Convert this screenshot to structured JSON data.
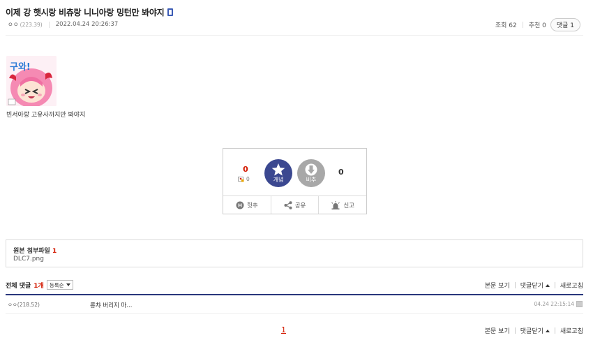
{
  "post": {
    "title": "이제 강 햇시랑 비츄랑 니니아랑 밍턴만 봐야지",
    "writer_name": "ㅇㅇ",
    "writer_ip": "(223.39)",
    "date": "2022.04.24 20:26:37",
    "views_label": "조회 62",
    "recommend_label": "추천 0",
    "comments_pill": "댓글 1",
    "sticker_text": "구와!",
    "body_text": "빈서아랑 고유사까지만 봐야지"
  },
  "vote": {
    "up_count": "0",
    "fixed_count": "0",
    "up_label": "개념",
    "down_label": "비추",
    "down_count": "0",
    "bottom": {
      "hit_label": "힛추",
      "share_label": "공유",
      "report_label": "신고",
      "hit_badge": "H"
    }
  },
  "attachments": {
    "label": "원본 첨부파일",
    "count": "1",
    "file": "DLC7.png"
  },
  "comments": {
    "header_prefix": "전체 댓글",
    "header_count": "1개",
    "sort_label": "등록순",
    "actions": {
      "view_body": "본문 보기",
      "close_comments": "댓글닫기",
      "refresh": "새로고침"
    },
    "items": [
      {
        "writer": "ㅇㅇ(218.52)",
        "text": "롱챠 버리지 마...",
        "time": "04.24 22:15:14"
      }
    ],
    "page": "1"
  },
  "colors": {
    "accent_navy": "#29367c",
    "vote_up": "#3b4890",
    "vote_down": "#a8a8a8",
    "highlight_red": "#d31900"
  }
}
